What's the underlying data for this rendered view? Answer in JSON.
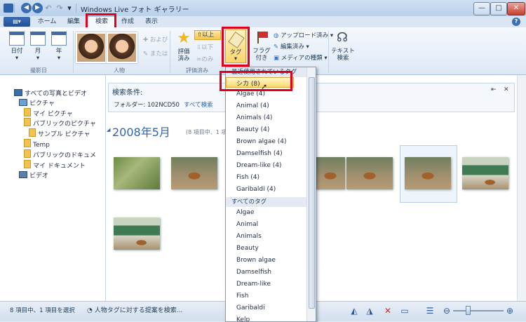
{
  "window": {
    "title": "Windows Live フォト ギャラリー",
    "minimize_glyph": "—",
    "maximize_glyph": "□",
    "close_glyph": "✕",
    "help_glyph": "?"
  },
  "quick_access": {
    "back_glyph": "◀",
    "forward_glyph": "▶",
    "undo_glyph": "↶",
    "redo_glyph": "↷",
    "more_glyph": "▾"
  },
  "app_menu_glyph": "▤▾",
  "tabs": [
    {
      "label": "ホーム"
    },
    {
      "label": "編集"
    },
    {
      "label": "検索"
    },
    {
      "label": "作成"
    },
    {
      "label": "表示"
    }
  ],
  "ribbon": {
    "date_group": {
      "label": "撮影日",
      "day": "日付",
      "month": "月",
      "year": "年"
    },
    "people_group": {
      "label": "人物",
      "add_label": "および",
      "or_label": "または"
    },
    "rating_group": {
      "label": "評価済み",
      "rated_label": "評価\n済み",
      "at_least": "以上",
      "at_most": "以下",
      "only": "のみ"
    },
    "tag_button": "タグ",
    "flag_button": "フラグ\n付き",
    "uploaded": "アップロード済み",
    "edited": "編集済み",
    "media_type": "メディアの種類",
    "text_search": "テキスト\n検索",
    "dropdown_arrow": "▾"
  },
  "nav": {
    "items": [
      {
        "label": "すべての写真とビデオ"
      },
      {
        "label": "ピクチャ"
      },
      {
        "label": "マイ ピクチャ"
      },
      {
        "label": "パブリックのピクチャ"
      },
      {
        "label": "サンプル ピクチャ"
      },
      {
        "label": "Temp"
      },
      {
        "label": "パブリックのドキュメ"
      },
      {
        "label": "マイ ドキュメント"
      },
      {
        "label": "ビデオ"
      }
    ]
  },
  "search": {
    "header": "検索条件:",
    "folder_label": "フォルダー: 102NCD50",
    "search_all": "すべて検索",
    "pin_glyph": "⇤",
    "close_glyph": "✕"
  },
  "gallery": {
    "date_heading": "2008年5月",
    "count_text": "(8 項目中、1 項"
  },
  "dropdown": {
    "recent_header": "最近使用されているタグ",
    "recent": [
      "シカ (8)",
      "Algae (4)",
      "Animal (4)",
      "Animals (4)",
      "Beauty (4)",
      "Brown algae (4)",
      "Damselfish (4)",
      "Dream-like (4)",
      "Fish (4)",
      "Garibaldi (4)"
    ],
    "all_header": "すべてのタグ",
    "all": [
      "Algae",
      "Animal",
      "Animals",
      "Beauty",
      "Brown algae",
      "Damselfish",
      "Dream-like",
      "Fish",
      "Garibaldi",
      "Kelp"
    ]
  },
  "status": {
    "selection": "8 項目中、1 項目を選択",
    "suggest": "人物タグに対する提案を検索..."
  },
  "colors": {
    "highlight": "#e0001b",
    "accent": "#3e6fb4"
  }
}
